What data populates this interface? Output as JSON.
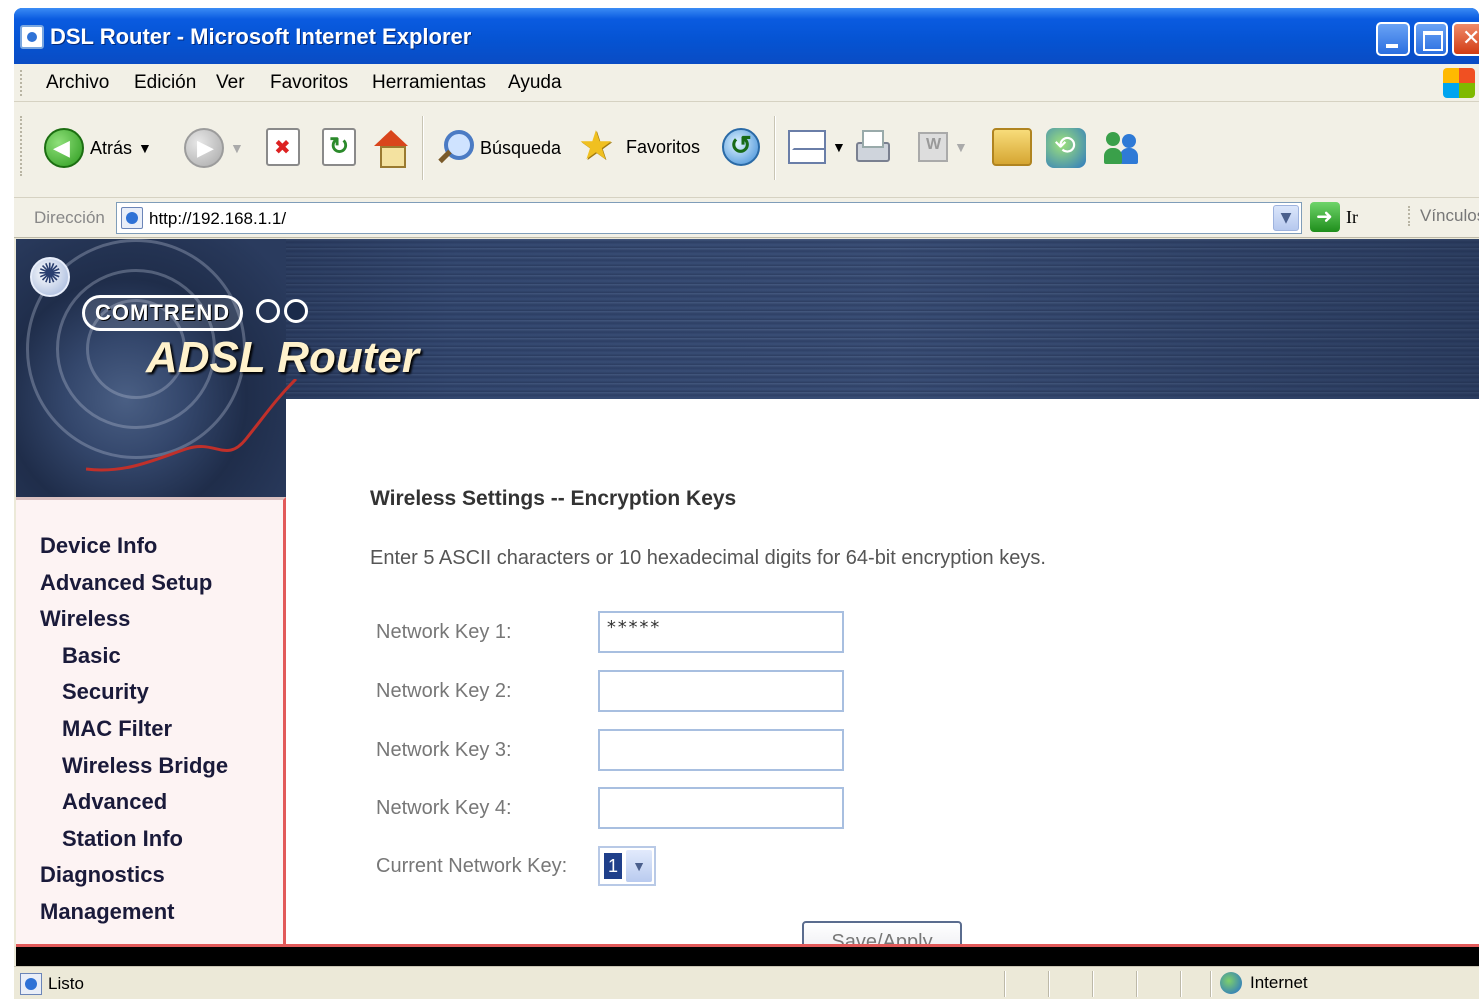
{
  "window": {
    "title": "DSL Router - Microsoft Internet Explorer"
  },
  "menubar": {
    "items": [
      "Archivo",
      "Edición",
      "Ver",
      "Favoritos",
      "Herramientas",
      "Ayuda"
    ]
  },
  "toolbar": {
    "back_label": "Atrás",
    "search_label": "Búsqueda",
    "favorites_label": "Favoritos"
  },
  "addressbar": {
    "label": "Dirección",
    "url": "http://192.168.1.1/",
    "go_label": "Ir",
    "links_label": "Vínculos"
  },
  "banner": {
    "brand": "COMTREND",
    "product": "ADSL Router"
  },
  "sidebar": {
    "items": [
      {
        "label": "Device Info",
        "level": 0
      },
      {
        "label": "Advanced Setup",
        "level": 0
      },
      {
        "label": "Wireless",
        "level": 0
      },
      {
        "label": "Basic",
        "level": 1
      },
      {
        "label": "Security",
        "level": 1
      },
      {
        "label": "MAC Filter",
        "level": 1
      },
      {
        "label": "Wireless Bridge",
        "level": 1
      },
      {
        "label": "Advanced",
        "level": 1
      },
      {
        "label": "Station Info",
        "level": 1
      },
      {
        "label": "Diagnostics",
        "level": 0
      },
      {
        "label": "Management",
        "level": 0
      }
    ]
  },
  "content": {
    "heading": "Wireless Settings -- Encryption Keys",
    "instruction": "Enter 5 ASCII characters or 10 hexadecimal digits for 64-bit encryption keys.",
    "keys": [
      {
        "label": "Network Key 1:",
        "value": "*****"
      },
      {
        "label": "Network Key 2:",
        "value": ""
      },
      {
        "label": "Network Key 3:",
        "value": ""
      },
      {
        "label": "Network Key 4:",
        "value": ""
      }
    ],
    "current_key_label": "Current Network Key:",
    "current_key_value": "1",
    "save_label": "Save/Apply"
  },
  "statusbar": {
    "text": "Listo",
    "zone": "Internet"
  },
  "colors": {
    "title_bar": "#0a55d8",
    "sidebar_border": "#e25a5a",
    "sidebar_bg": "#fdf3f3"
  }
}
